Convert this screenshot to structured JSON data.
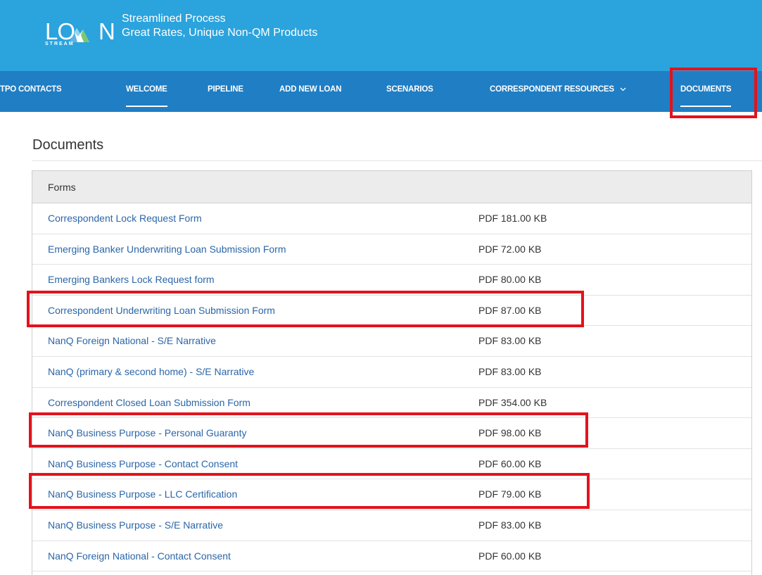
{
  "brand": {
    "logo_text_left": "LO",
    "logo_text_right": "N",
    "logo_subtext": "STREAM",
    "tagline_line1": "Streamlined Process",
    "tagline_line2": "Great Rates, Unique Non-QM Products"
  },
  "nav": {
    "items": [
      {
        "label": "TPO CONTACTS"
      },
      {
        "label": "WELCOME",
        "active": true
      },
      {
        "label": "PIPELINE"
      },
      {
        "label": "ADD NEW LOAN"
      },
      {
        "label": "SCENARIOS"
      },
      {
        "label": "CORRESPONDENT RESOURCES",
        "has_dropdown": true,
        "dropdown_icon": "chevron-down-icon"
      },
      {
        "label": "DOCUMENTS",
        "active": true,
        "highlighted": true
      }
    ]
  },
  "page": {
    "title": "Documents"
  },
  "forms": {
    "header": "Forms",
    "rows": [
      {
        "name": "Correspondent Lock Request Form",
        "size": "PDF 181.00 KB"
      },
      {
        "name": "Emerging Banker Underwriting Loan Submission Form",
        "size": "PDF 72.00 KB"
      },
      {
        "name": "Emerging Bankers Lock Request form",
        "size": "PDF 80.00 KB"
      },
      {
        "name": "Correspondent Underwriting Loan Submission Form",
        "size": "PDF 87.00 KB",
        "highlighted": true
      },
      {
        "name": "NanQ Foreign National - S/E Narrative",
        "size": "PDF 83.00 KB"
      },
      {
        "name": "NanQ (primary & second home) - S/E Narrative",
        "size": "PDF 83.00 KB"
      },
      {
        "name": "Correspondent Closed Loan Submission Form",
        "size": "PDF 354.00 KB"
      },
      {
        "name": "NanQ Business Purpose - Personal Guaranty",
        "size": "PDF 98.00 KB",
        "highlighted": true
      },
      {
        "name": "NanQ Business Purpose - Contact Consent",
        "size": "PDF 60.00 KB"
      },
      {
        "name": "NanQ Business Purpose - LLC Certification",
        "size": "PDF 79.00 KB",
        "highlighted": true
      },
      {
        "name": "NanQ Business Purpose - S/E Narrative",
        "size": "PDF 83.00 KB"
      },
      {
        "name": "NanQ Foreign National - Contact Consent",
        "size": "PDF 60.00 KB"
      }
    ]
  },
  "colors": {
    "topbar": "#2ba3dd",
    "navbar": "#1f7ec4",
    "link": "#2a66a8",
    "highlight": "#e3121b"
  }
}
